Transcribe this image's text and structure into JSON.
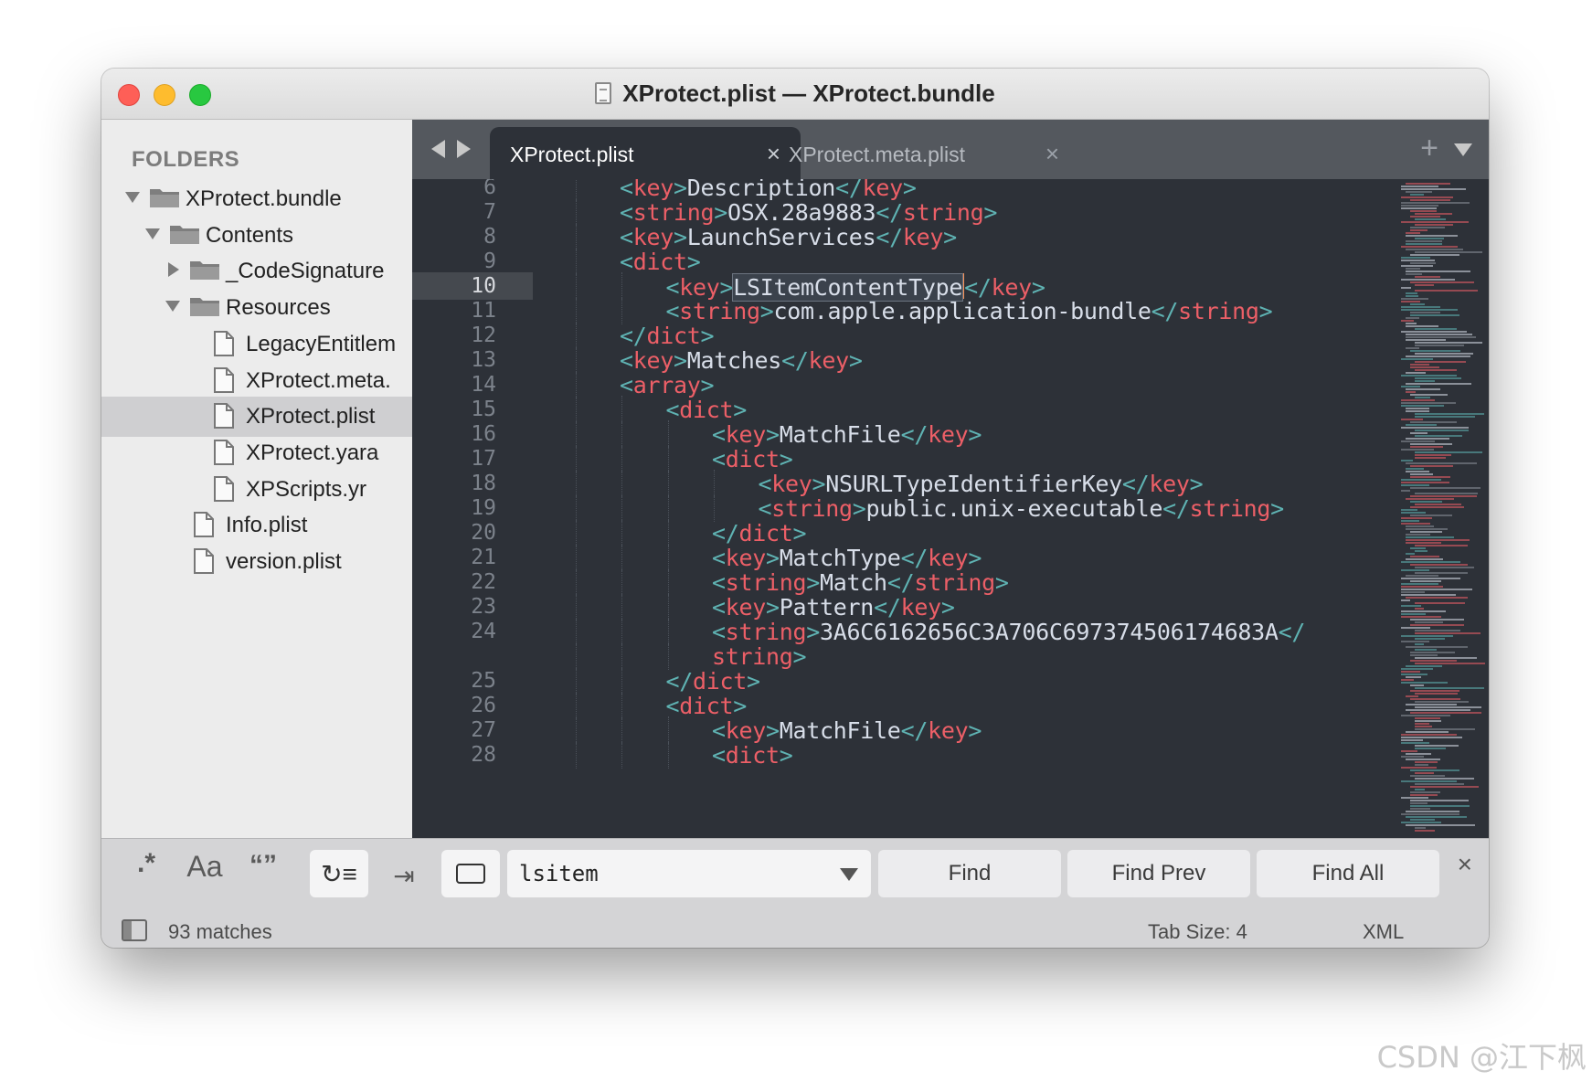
{
  "window": {
    "title": "XProtect.plist — XProtect.bundle"
  },
  "sidebar": {
    "heading": "FOLDERS",
    "items": [
      {
        "label": "XProtect.bundle",
        "type": "folder",
        "depth": 0,
        "expanded": true
      },
      {
        "label": "Contents",
        "type": "folder",
        "depth": 1,
        "expanded": true
      },
      {
        "label": "_CodeSignature",
        "type": "folder",
        "depth": 2,
        "expanded": false
      },
      {
        "label": "Resources",
        "type": "folder",
        "depth": 2,
        "expanded": true
      },
      {
        "label": "LegacyEntitlem",
        "type": "file",
        "depth": 3
      },
      {
        "label": "XProtect.meta.",
        "type": "file",
        "depth": 3
      },
      {
        "label": "XProtect.plist",
        "type": "file",
        "depth": 3,
        "selected": true
      },
      {
        "label": "XProtect.yara",
        "type": "file",
        "depth": 3
      },
      {
        "label": "XPScripts.yr",
        "type": "file",
        "depth": 3
      },
      {
        "label": "Info.plist",
        "type": "file",
        "depth": 2
      },
      {
        "label": "version.plist",
        "type": "file",
        "depth": 2
      }
    ]
  },
  "tabs": [
    {
      "label": "XProtect.plist",
      "active": true,
      "close": "×"
    },
    {
      "label": "XProtect.meta.plist",
      "active": false,
      "close": "×"
    }
  ],
  "tabbar": {
    "new_tab": "+"
  },
  "editor": {
    "current_line": "10",
    "lines": [
      {
        "n": "6",
        "indent": 2,
        "parts": [
          [
            "b",
            "<"
          ],
          [
            "t",
            "key"
          ],
          [
            "b",
            ">"
          ],
          [
            "x",
            "Description"
          ],
          [
            "b",
            "</"
          ],
          [
            "t",
            "key"
          ],
          [
            "b",
            ">"
          ]
        ]
      },
      {
        "n": "7",
        "indent": 2,
        "parts": [
          [
            "b",
            "<"
          ],
          [
            "t",
            "string"
          ],
          [
            "b",
            ">"
          ],
          [
            "x",
            "OSX.28a9883"
          ],
          [
            "b",
            "</"
          ],
          [
            "t",
            "string"
          ],
          [
            "b",
            ">"
          ]
        ]
      },
      {
        "n": "8",
        "indent": 2,
        "parts": [
          [
            "b",
            "<"
          ],
          [
            "t",
            "key"
          ],
          [
            "b",
            ">"
          ],
          [
            "x",
            "LaunchServices"
          ],
          [
            "b",
            "</"
          ],
          [
            "t",
            "key"
          ],
          [
            "b",
            ">"
          ]
        ]
      },
      {
        "n": "9",
        "indent": 2,
        "parts": [
          [
            "b",
            "<"
          ],
          [
            "t",
            "dict"
          ],
          [
            "b",
            ">"
          ]
        ]
      },
      {
        "n": "10",
        "indent": 3,
        "parts": [
          [
            "b",
            "<"
          ],
          [
            "t",
            "key"
          ],
          [
            "b",
            ">"
          ],
          [
            "s",
            "LSItemContentType"
          ],
          [
            "c",
            ""
          ],
          [
            "b",
            "</"
          ],
          [
            "t",
            "key"
          ],
          [
            "b",
            ">"
          ]
        ]
      },
      {
        "n": "11",
        "indent": 3,
        "parts": [
          [
            "b",
            "<"
          ],
          [
            "t",
            "string"
          ],
          [
            "b",
            ">"
          ],
          [
            "x",
            "com.apple.application-bundle"
          ],
          [
            "b",
            "</"
          ],
          [
            "t",
            "string"
          ],
          [
            "b",
            ">"
          ]
        ]
      },
      {
        "n": "12",
        "indent": 2,
        "parts": [
          [
            "b",
            "</"
          ],
          [
            "t",
            "dict"
          ],
          [
            "b",
            ">"
          ]
        ]
      },
      {
        "n": "13",
        "indent": 2,
        "parts": [
          [
            "b",
            "<"
          ],
          [
            "t",
            "key"
          ],
          [
            "b",
            ">"
          ],
          [
            "x",
            "Matches"
          ],
          [
            "b",
            "</"
          ],
          [
            "t",
            "key"
          ],
          [
            "b",
            ">"
          ]
        ]
      },
      {
        "n": "14",
        "indent": 2,
        "parts": [
          [
            "b",
            "<"
          ],
          [
            "t",
            "array"
          ],
          [
            "b",
            ">"
          ]
        ]
      },
      {
        "n": "15",
        "indent": 3,
        "parts": [
          [
            "b",
            "<"
          ],
          [
            "t",
            "dict"
          ],
          [
            "b",
            ">"
          ]
        ]
      },
      {
        "n": "16",
        "indent": 4,
        "parts": [
          [
            "b",
            "<"
          ],
          [
            "t",
            "key"
          ],
          [
            "b",
            ">"
          ],
          [
            "x",
            "MatchFile"
          ],
          [
            "b",
            "</"
          ],
          [
            "t",
            "key"
          ],
          [
            "b",
            ">"
          ]
        ]
      },
      {
        "n": "17",
        "indent": 4,
        "parts": [
          [
            "b",
            "<"
          ],
          [
            "t",
            "dict"
          ],
          [
            "b",
            ">"
          ]
        ]
      },
      {
        "n": "18",
        "indent": 5,
        "parts": [
          [
            "b",
            "<"
          ],
          [
            "t",
            "key"
          ],
          [
            "b",
            ">"
          ],
          [
            "x",
            "NSURLTypeIdentifierKey"
          ],
          [
            "b",
            "</"
          ],
          [
            "t",
            "key"
          ],
          [
            "b",
            ">"
          ]
        ]
      },
      {
        "n": "19",
        "indent": 5,
        "parts": [
          [
            "b",
            "<"
          ],
          [
            "t",
            "string"
          ],
          [
            "b",
            ">"
          ],
          [
            "x",
            "public.unix-executable"
          ],
          [
            "b",
            "</"
          ],
          [
            "t",
            "string"
          ],
          [
            "b",
            ">"
          ]
        ]
      },
      {
        "n": "20",
        "indent": 4,
        "parts": [
          [
            "b",
            "</"
          ],
          [
            "t",
            "dict"
          ],
          [
            "b",
            ">"
          ]
        ]
      },
      {
        "n": "21",
        "indent": 4,
        "parts": [
          [
            "b",
            "<"
          ],
          [
            "t",
            "key"
          ],
          [
            "b",
            ">"
          ],
          [
            "x",
            "MatchType"
          ],
          [
            "b",
            "</"
          ],
          [
            "t",
            "key"
          ],
          [
            "b",
            ">"
          ]
        ]
      },
      {
        "n": "22",
        "indent": 4,
        "parts": [
          [
            "b",
            "<"
          ],
          [
            "t",
            "string"
          ],
          [
            "b",
            ">"
          ],
          [
            "x",
            "Match"
          ],
          [
            "b",
            "</"
          ],
          [
            "t",
            "string"
          ],
          [
            "b",
            ">"
          ]
        ]
      },
      {
        "n": "23",
        "indent": 4,
        "parts": [
          [
            "b",
            "<"
          ],
          [
            "t",
            "key"
          ],
          [
            "b",
            ">"
          ],
          [
            "x",
            "Pattern"
          ],
          [
            "b",
            "</"
          ],
          [
            "t",
            "key"
          ],
          [
            "b",
            ">"
          ]
        ]
      },
      {
        "n": "24",
        "indent": 4,
        "parts": [
          [
            "b",
            "<"
          ],
          [
            "t",
            "string"
          ],
          [
            "b",
            ">"
          ],
          [
            "x",
            "3A6C6162656C3A706C697374506174683A"
          ],
          [
            "b",
            "</"
          ]
        ]
      },
      {
        "n": "",
        "indent": 4,
        "parts": [
          [
            "t",
            "string"
          ],
          [
            "b",
            ">"
          ]
        ]
      },
      {
        "n": "25",
        "indent": 3,
        "parts": [
          [
            "b",
            "</"
          ],
          [
            "t",
            "dict"
          ],
          [
            "b",
            ">"
          ]
        ]
      },
      {
        "n": "26",
        "indent": 3,
        "parts": [
          [
            "b",
            "<"
          ],
          [
            "t",
            "dict"
          ],
          [
            "b",
            ">"
          ]
        ]
      },
      {
        "n": "27",
        "indent": 4,
        "parts": [
          [
            "b",
            "<"
          ],
          [
            "t",
            "key"
          ],
          [
            "b",
            ">"
          ],
          [
            "x",
            "MatchFile"
          ],
          [
            "b",
            "</"
          ],
          [
            "t",
            "key"
          ],
          [
            "b",
            ">"
          ]
        ]
      },
      {
        "n": "28",
        "indent": 4,
        "parts": [
          [
            "b",
            "<"
          ],
          [
            "t",
            "dict"
          ],
          [
            "b",
            ">"
          ]
        ]
      }
    ]
  },
  "findbar": {
    "regex_label": ".*",
    "case_label": "Aa",
    "word_label": "“”",
    "wrap_label": "↻≡",
    "selection_label": "⇥",
    "query": "lsitem",
    "find_label": "Find",
    "find_prev_label": "Find Prev",
    "find_all_label": "Find All",
    "close": "×"
  },
  "statusbar": {
    "matches": "93 matches",
    "tab_size": "Tab Size: 4",
    "syntax": "XML"
  },
  "watermark": "CSDN @江下枫",
  "colors": {
    "bracket": "#5fb3b3",
    "tag": "#ec5f67",
    "text": "#d8dee9",
    "caret": "#f99157"
  }
}
